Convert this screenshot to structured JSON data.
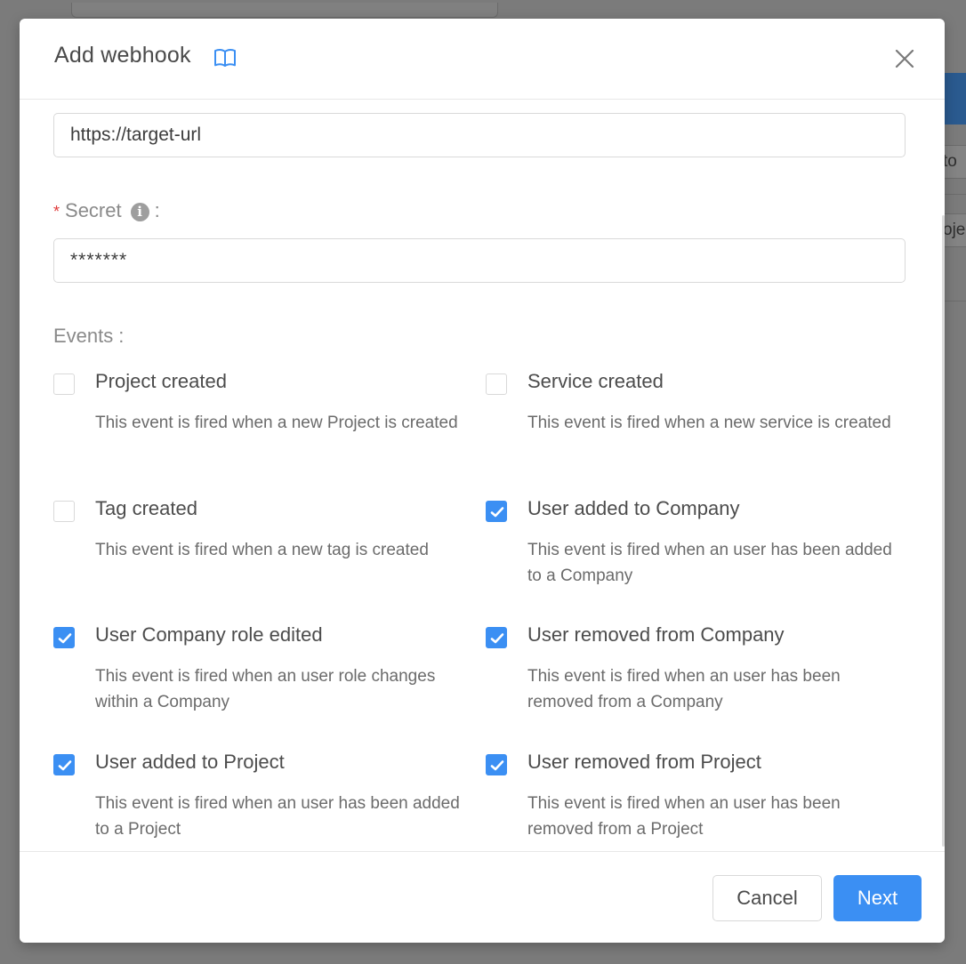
{
  "background": {
    "row1_text": "to",
    "row2_text": "oje"
  },
  "modal": {
    "title": "Add webhook",
    "docs_icon": "book-icon",
    "close_icon": "close-icon"
  },
  "form": {
    "url": {
      "value": "https://target-url"
    },
    "secret": {
      "label": "Secret",
      "required_mark": "*",
      "info_glyph": "i",
      "value": "*******"
    },
    "events_label": "Events",
    "events": [
      {
        "title": "Project created",
        "description": "This event is fired when a new Project is created",
        "checked": false
      },
      {
        "title": "Service created",
        "description": "This event is fired when a new service is created",
        "checked": false
      },
      {
        "title": "Tag created",
        "description": "This event is fired when a new tag is created",
        "checked": false
      },
      {
        "title": "User added to Company",
        "description": "This event is fired when an user has been added to a Company",
        "checked": true
      },
      {
        "title": "User Company role edited",
        "description": "This event is fired when an user role changes within a Company",
        "checked": true
      },
      {
        "title": "User removed from Company",
        "description": "This event is fired when an user has been removed from a Company",
        "checked": true
      },
      {
        "title": "User added to Project",
        "description": "This event is fired when an user has been added to a Project",
        "checked": true
      },
      {
        "title": "User removed from Project",
        "description": "This event is fired when an user has been removed from a Project",
        "checked": true
      }
    ]
  },
  "footer": {
    "cancel_label": "Cancel",
    "next_label": "Next"
  },
  "colors": {
    "accent": "#3b8ff3",
    "required": "#e03a3a",
    "overlay": "#7b7b7b"
  }
}
